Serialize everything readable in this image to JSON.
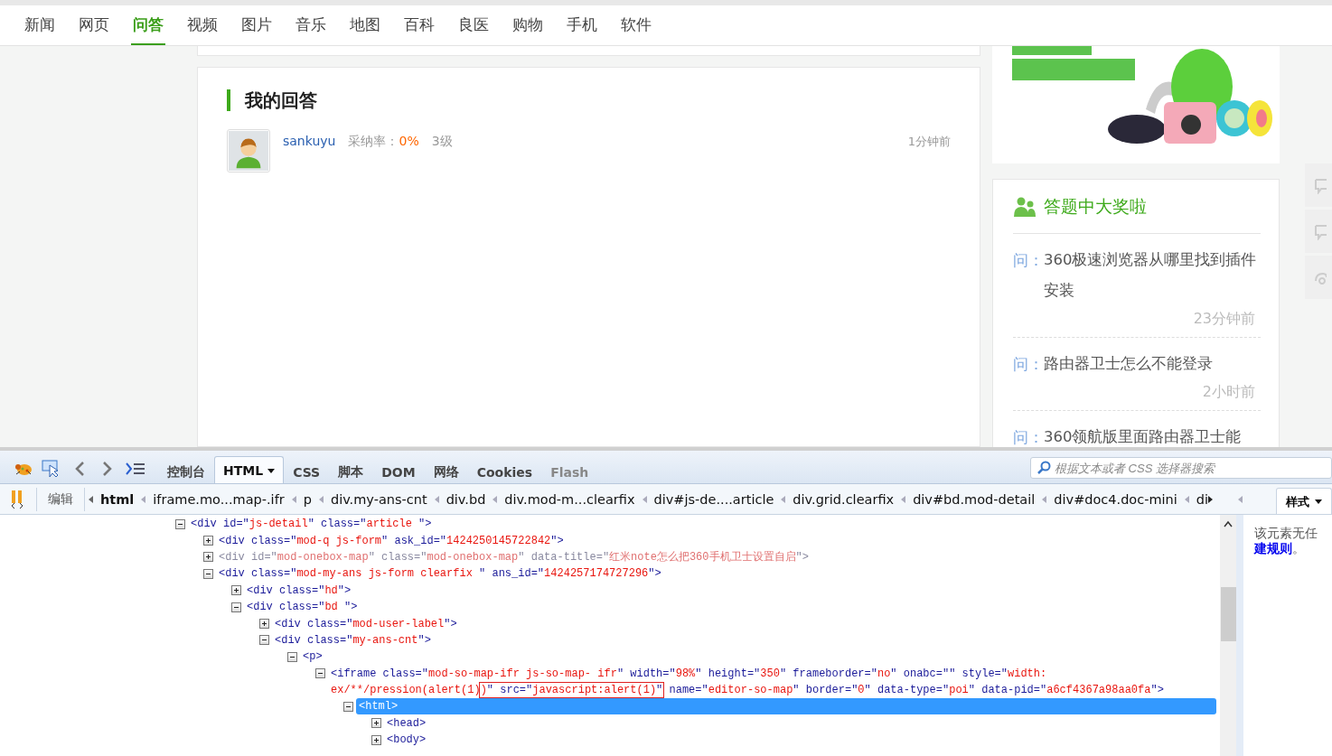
{
  "nav": [
    {
      "label": "新闻",
      "selected": false
    },
    {
      "label": "网页",
      "selected": false
    },
    {
      "label": "问答",
      "selected": true
    },
    {
      "label": "视频",
      "selected": false
    },
    {
      "label": "图片",
      "selected": false
    },
    {
      "label": "音乐",
      "selected": false
    },
    {
      "label": "地图",
      "selected": false
    },
    {
      "label": "百科",
      "selected": false
    },
    {
      "label": "良医",
      "selected": false
    },
    {
      "label": "购物",
      "selected": false
    },
    {
      "label": "手机",
      "selected": false
    },
    {
      "label": "软件",
      "selected": false
    }
  ],
  "answer": {
    "title": "我的回答",
    "user": "sankuyu",
    "rate_label": "采纳率：",
    "rate": "0%",
    "level": "3级",
    "time": "1分钟前"
  },
  "sidebar": {
    "title": "答题中大奖啦",
    "questions": [
      {
        "prefix": "问：",
        "title": "360极速浏览器从哪里找到插件安装",
        "time": "23分钟前"
      },
      {
        "prefix": "问：",
        "title": "路由器卫士怎么不能登录",
        "time": "2小时前"
      },
      {
        "prefix": "问：",
        "title": "360领航版里面路由器卫士能"
      }
    ]
  },
  "devtools": {
    "tabs": [
      {
        "label": "控制台",
        "selected": false,
        "disabled": false
      },
      {
        "label": "HTML",
        "selected": true,
        "disabled": false
      },
      {
        "label": "CSS",
        "selected": false,
        "disabled": false
      },
      {
        "label": "脚本",
        "selected": false,
        "disabled": false
      },
      {
        "label": "DOM",
        "selected": false,
        "disabled": false
      },
      {
        "label": "网络",
        "selected": false,
        "disabled": false
      },
      {
        "label": "Cookies",
        "selected": false,
        "disabled": false
      },
      {
        "label": "Flash",
        "selected": false,
        "disabled": true
      }
    ],
    "search": {
      "placeholder": "根据文本或者 CSS 选择器搜索"
    },
    "edit_button": "编辑",
    "breadcrumbs": [
      {
        "label": "html",
        "selected": true
      },
      {
        "label": "iframe.mo...map-.ifr",
        "selected": false
      },
      {
        "label": "p",
        "selected": false
      },
      {
        "label": "div.my-ans-cnt",
        "selected": false
      },
      {
        "label": "div.bd",
        "selected": false
      },
      {
        "label": "div.mod-m...clearfix",
        "selected": false
      },
      {
        "label": "div#js-de....article",
        "selected": false
      },
      {
        "label": "div.grid.clearfix",
        "selected": false
      },
      {
        "label": "div#bd.mod-detail",
        "selected": false
      },
      {
        "label": "div#doc4.doc-mini",
        "selected": false
      },
      {
        "label": "di",
        "selected": false
      }
    ],
    "side_tab": "样式",
    "code_tree": [
      {
        "expanded": true,
        "selected": false,
        "lines": [
          [
            {
              "kind": "tag",
              "text": "<div id=\""
            },
            {
              "kind": "value",
              "text": "js-detail"
            },
            {
              "kind": "tag",
              "text": "\" class=\""
            },
            {
              "kind": "value",
              "text": "article "
            },
            {
              "kind": "tag",
              "text": "\">"
            }
          ]
        ],
        "children": [
          {
            "expanded": false,
            "selected": false,
            "dimmed": false,
            "lines": [
              [
                {
                  "kind": "tag",
                  "text": "<div class=\""
                },
                {
                  "kind": "value",
                  "text": "mod-q js-form"
                },
                {
                  "kind": "tag",
                  "text": "\" ask_id=\""
                },
                {
                  "kind": "value",
                  "text": "1424250145722842"
                },
                {
                  "kind": "tag",
                  "text": "\">"
                }
              ]
            ]
          },
          {
            "expanded": false,
            "selected": false,
            "dimmed": true,
            "lines": [
              [
                {
                  "kind": "tag",
                  "text": "<div id=\""
                },
                {
                  "kind": "value",
                  "text": "mod-onebox-map"
                },
                {
                  "kind": "tag",
                  "text": "\" class=\""
                },
                {
                  "kind": "value",
                  "text": "mod-onebox-map"
                },
                {
                  "kind": "tag",
                  "text": "\" data-title=\""
                },
                {
                  "kind": "value",
                  "text": "红米note怎么把360手机卫士设置自启"
                },
                {
                  "kind": "tag",
                  "text": "\">"
                }
              ]
            ]
          },
          {
            "expanded": true,
            "selected": false,
            "dimmed": false,
            "lines": [
              [
                {
                  "kind": "tag",
                  "text": "<div class=\""
                },
                {
                  "kind": "value",
                  "text": "mod-my-ans js-form clearfix "
                },
                {
                  "kind": "tag",
                  "text": "\" ans_id=\""
                },
                {
                  "kind": "value",
                  "text": "1424257174727296"
                },
                {
                  "kind": "tag",
                  "text": "\">"
                }
              ]
            ],
            "children": [
              {
                "expanded": false,
                "selected": false,
                "lines": [
                  [
                    {
                      "kind": "tag",
                      "text": "<div class=\""
                    },
                    {
                      "kind": "value",
                      "text": "hd"
                    },
                    {
                      "kind": "tag",
                      "text": "\">"
                    }
                  ]
                ]
              },
              {
                "expanded": true,
                "selected": false,
                "lines": [
                  [
                    {
                      "kind": "tag",
                      "text": "<div class=\""
                    },
                    {
                      "kind": "value",
                      "text": "bd "
                    },
                    {
                      "kind": "tag",
                      "text": "\">"
                    }
                  ]
                ],
                "children": [
                  {
                    "expanded": false,
                    "selected": false,
                    "lines": [
                      [
                        {
                          "kind": "tag",
                          "text": "<div class=\""
                        },
                        {
                          "kind": "value",
                          "text": "mod-user-label"
                        },
                        {
                          "kind": "tag",
                          "text": "\">"
                        }
                      ]
                    ]
                  },
                  {
                    "expanded": true,
                    "selected": false,
                    "lines": [
                      [
                        {
                          "kind": "tag",
                          "text": "<div class=\""
                        },
                        {
                          "kind": "value",
                          "text": "my-ans-cnt"
                        },
                        {
                          "kind": "tag",
                          "text": "\">"
                        }
                      ]
                    ],
                    "children": [
                      {
                        "expanded": true,
                        "selected": false,
                        "lines": [
                          [
                            {
                              "kind": "tag",
                              "text": "<p>"
                            }
                          ]
                        ],
                        "children": [
                          {
                            "expanded": true,
                            "selected": false,
                            "lines": [
                              [
                                {
                                  "kind": "tag",
                                  "text": "<iframe class=\""
                                },
                                {
                                  "kind": "value",
                                  "text": "mod-so-map-ifr js-so-map- ifr"
                                },
                                {
                                  "kind": "tag",
                                  "text": "\" width=\""
                                },
                                {
                                  "kind": "value",
                                  "text": "98%"
                                },
                                {
                                  "kind": "tag",
                                  "text": "\" height=\""
                                },
                                {
                                  "kind": "value",
                                  "text": "350"
                                },
                                {
                                  "kind": "tag",
                                  "text": "\" frameborder=\""
                                },
                                {
                                  "kind": "value",
                                  "text": "no"
                                },
                                {
                                  "kind": "tag",
                                  "text": "\" onabc=\"\" style=\""
                                },
                                {
                                  "kind": "value",
                                  "text": "width:"
                                }
                              ],
                              [
                                {
                                  "kind": "value",
                                  "text": "ex/**/pression(alert(1)"
                                },
                                {
                                  "kind": "value",
                                  "text": ")",
                                  "boxed": true
                                },
                                {
                                  "kind": "tag",
                                  "text": "\" src=\"",
                                  "boxed": true
                                },
                                {
                                  "kind": "value",
                                  "text": "javascript:alert(1)",
                                  "boxed": true
                                },
                                {
                                  "kind": "tag",
                                  "text": "\"",
                                  "boxed": true
                                },
                                {
                                  "kind": "tag",
                                  "text": " name=\""
                                },
                                {
                                  "kind": "value",
                                  "text": "editor-so-map"
                                },
                                {
                                  "kind": "tag",
                                  "text": "\" border=\""
                                },
                                {
                                  "kind": "value",
                                  "text": "0"
                                },
                                {
                                  "kind": "tag",
                                  "text": "\" data-type=\""
                                },
                                {
                                  "kind": "value",
                                  "text": "poi"
                                },
                                {
                                  "kind": "tag",
                                  "text": "\" data-pid=\""
                                },
                                {
                                  "kind": "value",
                                  "text": "a6cf4367a98aa0fa"
                                },
                                {
                                  "kind": "tag",
                                  "text": "\">"
                                }
                              ]
                            ],
                            "children": [
                              {
                                "expanded": true,
                                "selected": true,
                                "lines": [
                                  [
                                    {
                                      "kind": "tag",
                                      "text": "<html>"
                                    }
                                  ]
                                ],
                                "children": [
                                  {
                                    "expanded": false,
                                    "selected": false,
                                    "lines": [
                                      [
                                        {
                                          "kind": "tag",
                                          "text": "<head>"
                                        }
                                      ]
                                    ]
                                  },
                                  {
                                    "expanded": false,
                                    "selected": false,
                                    "lines": [
                                      [
                                        {
                                          "kind": "tag",
                                          "text": "<body>"
                                        }
                                      ]
                                    ]
                                  }
                                ]
                              }
                            ]
                          }
                        ]
                      }
                    ]
                  }
                ]
              }
            ]
          }
        ]
      }
    ],
    "rule_note": {
      "text": "该元素无任",
      "link": "建规则",
      "tail": "。"
    }
  }
}
